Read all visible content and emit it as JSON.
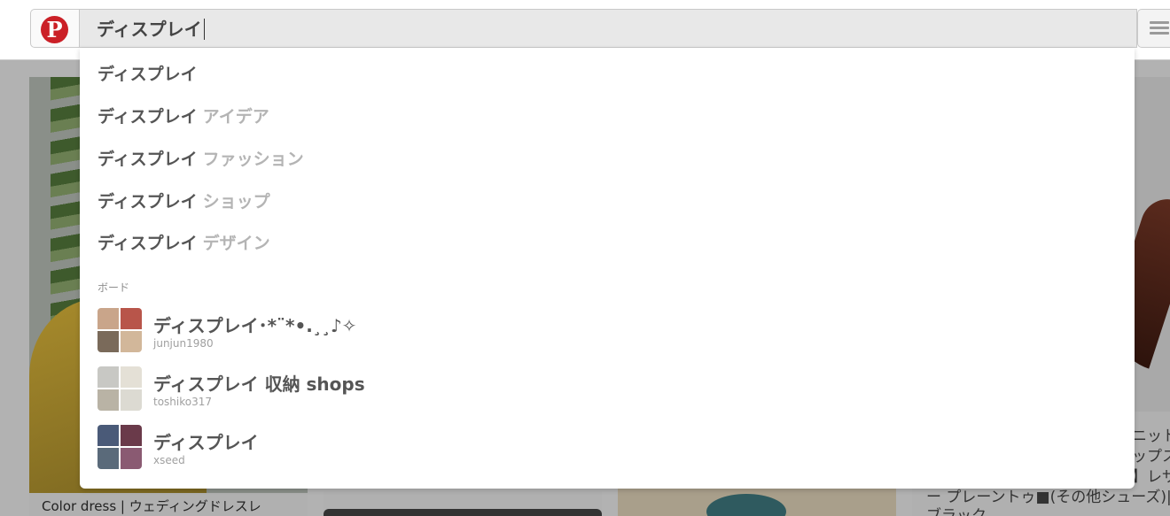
{
  "search": {
    "query": "ディスプレイ"
  },
  "suggestions": [
    {
      "match": "ディスプレイ",
      "rest": ""
    },
    {
      "match": "ディスプレイ",
      "rest": "アイデア"
    },
    {
      "match": "ディスプレイ",
      "rest": "ファッション"
    },
    {
      "match": "ディスプレイ",
      "rest": "ショップ"
    },
    {
      "match": "ディスプレイ",
      "rest": "デザイン"
    }
  ],
  "boards_section": {
    "label": "ボード",
    "items": [
      {
        "name": "ディスプレイ･*¨*•.¸¸♪✧",
        "owner": "junjun1980"
      },
      {
        "name": "ディスプレイ 収納 shops",
        "owner": "toshiko317"
      },
      {
        "name": "ディスプレイ",
        "owner": "xseed"
      }
    ]
  },
  "background_pins": {
    "pin1_caption": "Color dress | ウェディングドレスレ",
    "pin4_caption_lines": [
      "ニット",
      "ップス",
      "】レザ",
      "ー プレーントゥ■(その他シューズ)|",
      "ブラック"
    ]
  },
  "colors": {
    "brand": "#cb2027",
    "overlay_bg": "#b2b2b2",
    "suggestion_match": "#555555",
    "suggestion_rest": "#b4b4b4"
  },
  "icons": {
    "logo": "pinterest-logo-icon",
    "menu": "hamburger-menu-icon"
  }
}
